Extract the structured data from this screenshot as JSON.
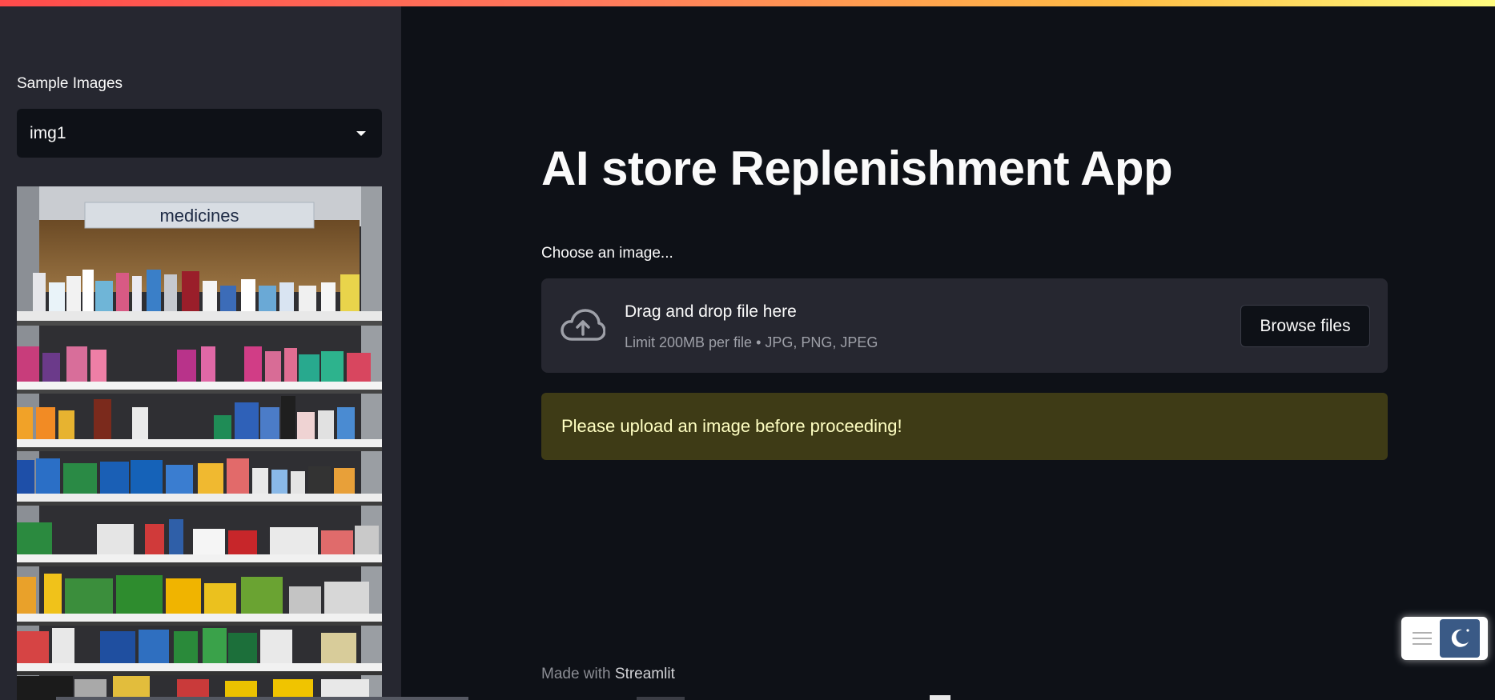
{
  "sidebar": {
    "label": "Sample Images",
    "select": {
      "value": "img1"
    },
    "image": {
      "shelf_sign": "medicines"
    }
  },
  "main": {
    "title": "AI store Replenishment App",
    "uploader": {
      "label": "Choose an image...",
      "drop_text": "Drag and drop file here",
      "limit_text": "Limit 200MB per file • JPG, PNG, JPEG",
      "browse_label": "Browse files"
    },
    "warning": "Please upload an image before proceeding!"
  },
  "footer": {
    "prefix": "Made with",
    "brand": "Streamlit"
  },
  "colors": {
    "background": "#0e1117",
    "sidebar": "#262730",
    "warning_bg": "#3e3b16",
    "warning_text": "#ffffc2"
  },
  "icons": [
    "chevron-down-icon",
    "upload-cloud-icon",
    "menu-icon",
    "moon-icon"
  ]
}
